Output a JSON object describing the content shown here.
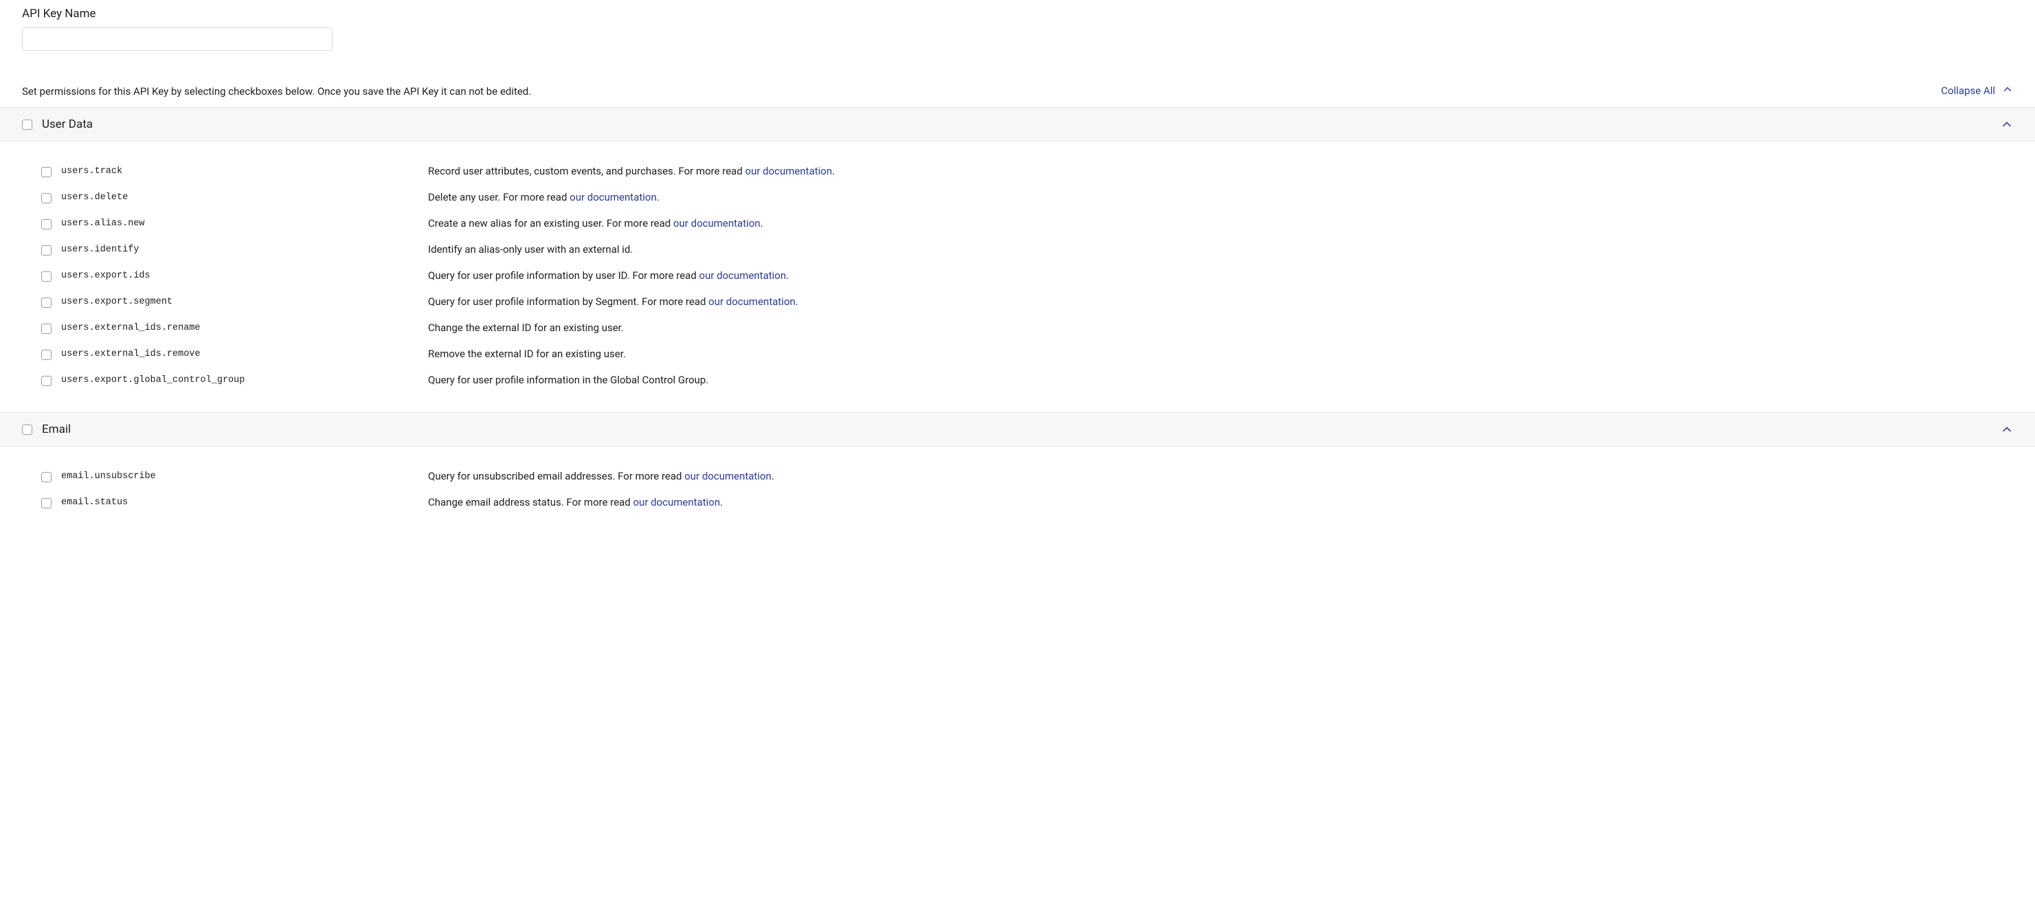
{
  "form": {
    "api_key_name_label": "API Key Name",
    "api_key_name_value": ""
  },
  "instructions": "Set permissions for this API Key by selecting checkboxes below. Once you save the API Key it can not be edited.",
  "collapse_all_label": "Collapse All",
  "link_text": "our documentation",
  "groups": [
    {
      "title": "User Data",
      "permissions": [
        {
          "code": "users.track",
          "desc_pre": "Record user attributes, custom events, and purchases. For more read ",
          "has_link": true,
          "desc_post": "."
        },
        {
          "code": "users.delete",
          "desc_pre": "Delete any user. For more read ",
          "has_link": true,
          "desc_post": "."
        },
        {
          "code": "users.alias.new",
          "desc_pre": "Create a new alias for an existing user. For more read ",
          "has_link": true,
          "desc_post": "."
        },
        {
          "code": "users.identify",
          "desc_pre": "Identify an alias-only user with an external id.",
          "has_link": false,
          "desc_post": ""
        },
        {
          "code": "users.export.ids",
          "desc_pre": "Query for user profile information by user ID. For more read ",
          "has_link": true,
          "desc_post": "."
        },
        {
          "code": "users.export.segment",
          "desc_pre": "Query for user profile information by Segment. For more read ",
          "has_link": true,
          "desc_post": "."
        },
        {
          "code": "users.external_ids.rename",
          "desc_pre": "Change the external ID for an existing user.",
          "has_link": false,
          "desc_post": ""
        },
        {
          "code": "users.external_ids.remove",
          "desc_pre": "Remove the external ID for an existing user.",
          "has_link": false,
          "desc_post": ""
        },
        {
          "code": "users.export.global_control_group",
          "desc_pre": "Query for user profile information in the Global Control Group.",
          "has_link": false,
          "desc_post": ""
        }
      ]
    },
    {
      "title": "Email",
      "permissions": [
        {
          "code": "email.unsubscribe",
          "desc_pre": "Query for unsubscribed email addresses. For more read ",
          "has_link": true,
          "desc_post": "."
        },
        {
          "code": "email.status",
          "desc_pre": "Change email address status. For more read ",
          "has_link": true,
          "desc_post": "."
        }
      ]
    }
  ]
}
